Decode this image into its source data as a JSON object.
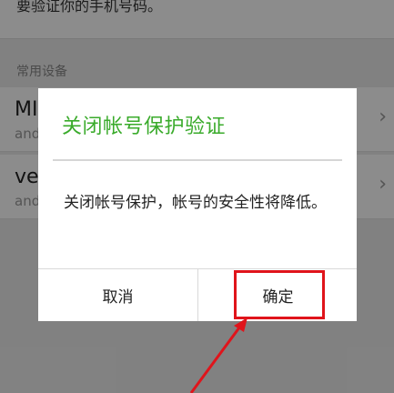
{
  "background": {
    "top_text": "要验证你的手机号码。",
    "section_label": "常用设备",
    "devices": [
      {
        "name": "MI",
        "sub": "and"
      },
      {
        "name": "ve",
        "sub": "and"
      }
    ]
  },
  "dialog": {
    "title": "关闭帐号保护验证",
    "message": "关闭帐号保护，帐号的安全性将降低。",
    "cancel_label": "取消",
    "ok_label": "确定"
  },
  "colors": {
    "title_green": "#3aab2b",
    "highlight_red": "#e0141b"
  }
}
